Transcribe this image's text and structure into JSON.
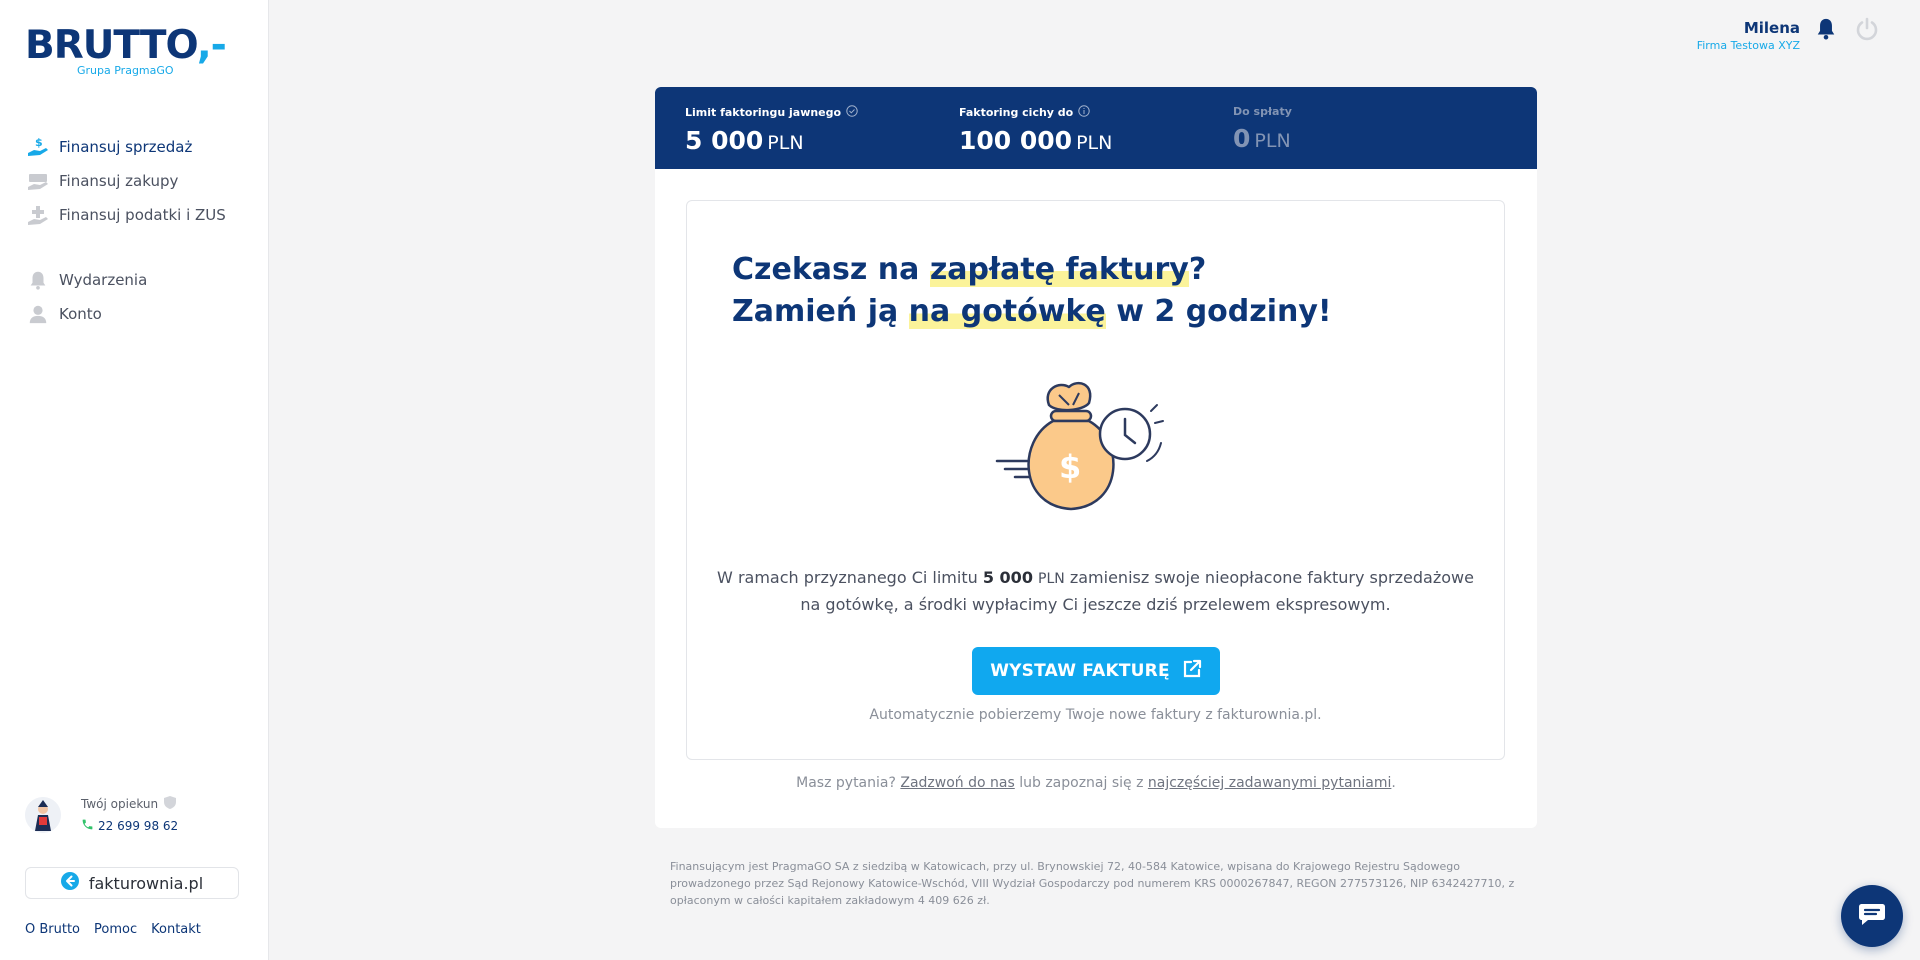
{
  "brand": {
    "logo": "BRUTTO",
    "logo_suffix": ",-",
    "sub": "Grupa PragmaGO"
  },
  "nav": {
    "main": [
      {
        "label": "Finansuj sprzedaż",
        "icon": "hand-dollar-icon",
        "active": true
      },
      {
        "label": "Finansuj zakupy",
        "icon": "cart-icon",
        "active": false
      },
      {
        "label": "Finansuj podatki i ZUS",
        "icon": "hand-plus-icon",
        "active": false
      }
    ],
    "secondary": [
      {
        "label": "Wydarzenia",
        "icon": "bell-icon"
      },
      {
        "label": "Konto",
        "icon": "user-icon"
      }
    ]
  },
  "guardian": {
    "title": "Twój opiekun",
    "phone": "22 699 98 62"
  },
  "back_button": {
    "label": "fakturownia.pl"
  },
  "footer_links": [
    "O Brutto",
    "Pomoc",
    "Kontakt"
  ],
  "user": {
    "name": "Milena",
    "company": "Firma Testowa XYZ"
  },
  "limits": [
    {
      "title": "Limit faktoringu jawnego",
      "value": "5 000",
      "currency": "PLN",
      "icon": "check-circle-icon",
      "dim": false
    },
    {
      "title": "Faktoring cichy do",
      "value": "100 000",
      "currency": "PLN",
      "icon": "info-circle-icon",
      "dim": false
    },
    {
      "title": "Do spłaty",
      "value": "0",
      "currency": "PLN",
      "icon": "",
      "dim": true
    }
  ],
  "headline": {
    "l1_pre": "Czekasz na ",
    "l1_hl": "zapłatę faktury",
    "l1_post": "?",
    "l2_pre": "Zamień ją ",
    "l2_hl": "na gotówkę",
    "l2_post": " w 2 godziny!"
  },
  "description": {
    "p1": "W ramach przyznanego Ci limitu ",
    "amount": "5 000",
    "currency": "PLN",
    "p2": " zamienisz swoje nieopłacone faktury sprzedażowe",
    "p3": "na gotówkę, a środki wypłacimy Ci jeszcze dziś przelewem ekspresowym."
  },
  "cta": {
    "label": "WYSTAW FAKTURĘ"
  },
  "auto_note": "Automatycznie pobierzemy Twoje nowe faktury z fakturownia.pl.",
  "help": {
    "pre": "Masz pytania? ",
    "link1": "Zadzwoń do nas",
    "mid": " lub zapoznaj się z ",
    "link2": "najczęściej zadawanymi pytaniami",
    "post": "."
  },
  "legal": "Finansującym jest PragmaGO SA z siedzibą w Katowicach, przy ul. Brynowskiej 72, 40-584 Katowice, wpisana do Krajowego Rejestru Sądowego prowadzonego przez Sąd Rejonowy Katowice-Wschód, VIII Wydział Gospodarczy pod numerem KRS 0000267847, REGON 277573126, NIP 6342427710, z opłaconym w całości kapitałem zakładowym 4 409 626 zł.",
  "colors": {
    "navy": "#0d3677",
    "accent": "#10a8ef",
    "highlight": "#fbf39a",
    "bag": "#fbc98a"
  }
}
